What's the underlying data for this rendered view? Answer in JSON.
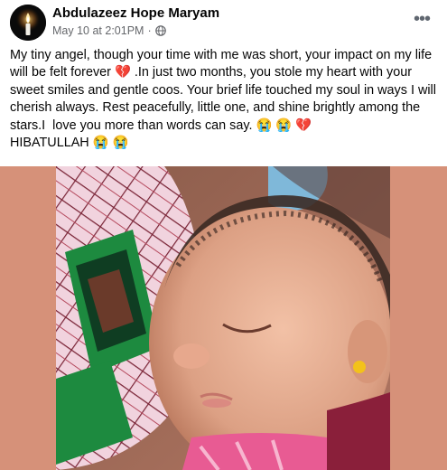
{
  "post": {
    "author": "Abdulazeez Hope Maryam",
    "timestamp": "May 10 at 2:01PM",
    "separator": "·",
    "privacy_icon": "globe-icon",
    "more_icon": "more-horizontal-icon",
    "more_label": "•••",
    "text": "My tiny angel, though your time with me was short, your impact on my life will be felt forever 💔 .In just two months, you stole my heart with your sweet smiles and gentle coos. Your brief life touched my soul in ways I will cherish always. Rest peacefully, little one, and shine brightly among the stars.I  love you more than words can say. 😭 😭 💔\nHIBATULLAH 😭 😭"
  },
  "colors": {
    "author_text": "#050505",
    "meta_text": "#65676b",
    "media_background": "#d69179"
  }
}
